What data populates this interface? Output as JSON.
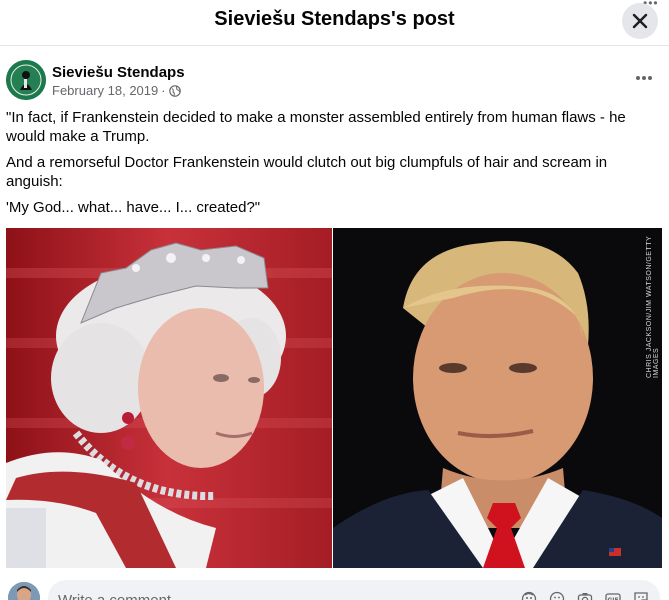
{
  "header": {
    "title": "Sieviešu Stendaps's post"
  },
  "post": {
    "author": "Sieviešu Stendaps",
    "date": "February 18, 2019",
    "separator": "·",
    "paragraphs": [
      "\"In fact, if Frankenstein decided to make a monster assembled entirely from human flaws - he would make a Trump.",
      "And a remorseful Doctor Frankenstein would clutch out big clumpfuls of hair and scream in anguish:",
      "'My God... what... have... I... created?\""
    ],
    "image_credit": "CHRIS JACKSON/JIM WATSON/GETTY IMAGES"
  },
  "comment": {
    "placeholder": "Write a comment..."
  },
  "icons": {
    "close": "close-icon",
    "more": "more-icon",
    "privacy": "globe-icon",
    "comment_tools": [
      "avatar-sticker-icon",
      "emoji-icon",
      "camera-icon",
      "gif-icon",
      "sticker-icon"
    ]
  },
  "colors": {
    "text": "#050505",
    "secondary": "#65676b",
    "brand_green": "#1a7a4b"
  }
}
